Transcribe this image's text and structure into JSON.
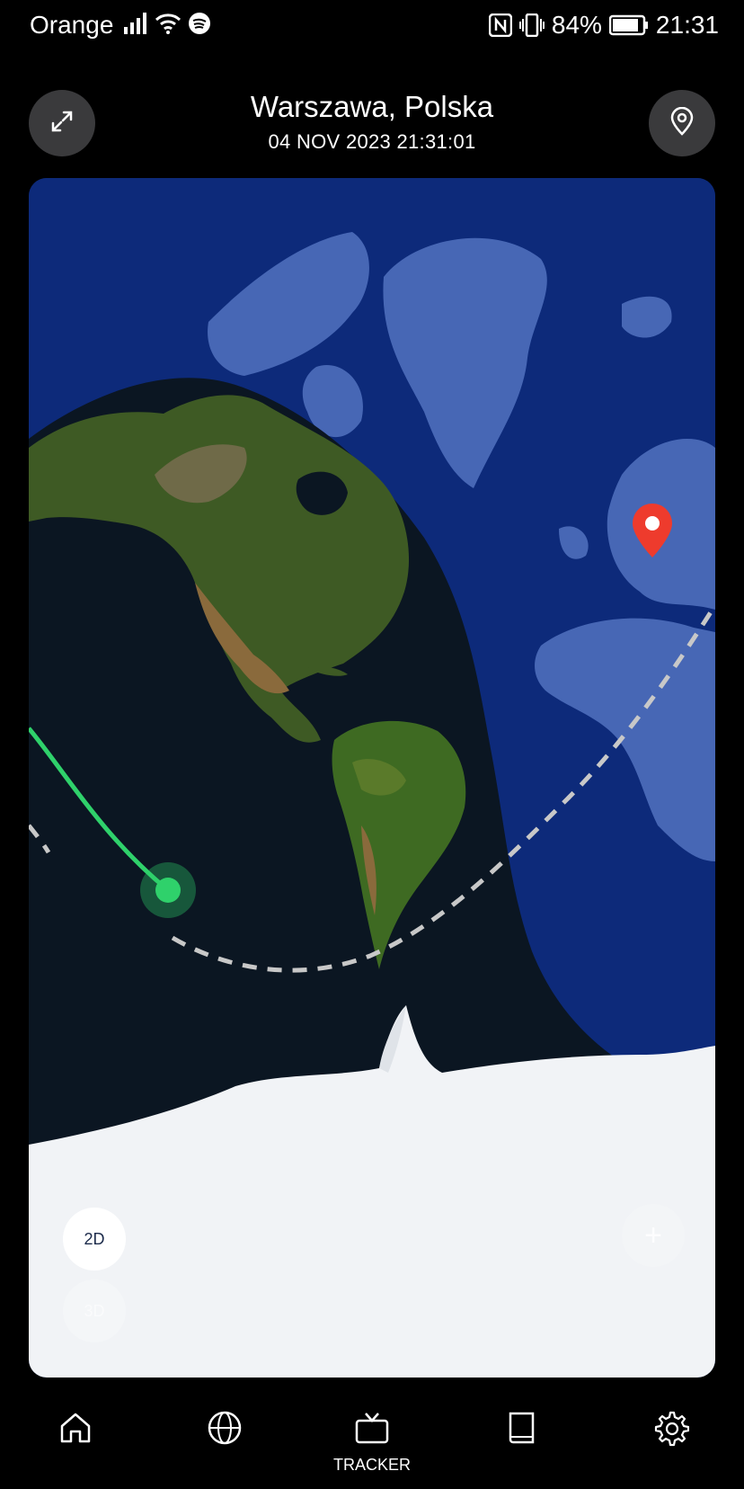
{
  "status_bar": {
    "carrier": "Orange",
    "battery": "84%",
    "time": "21:31",
    "icons": [
      "signal-icon",
      "wifi-icon",
      "spotify-icon",
      "nfc-icon",
      "vibrate-icon",
      "battery-icon"
    ]
  },
  "header": {
    "location": "Warszawa, Polska",
    "datetime": "04 NOV 2023 21:31:01",
    "left_button_icon": "expand-icon",
    "right_button_icon": "location-pin-icon"
  },
  "map": {
    "view_2d_label": "2D",
    "view_3d_label": "3D",
    "zoom_in_label": "+",
    "colors": {
      "ocean_day": "#0d2a7a",
      "night_side": "#0b1622",
      "orbit_past": "#2fd16b",
      "orbit_future": "#c8c8c8",
      "pin": "#ee3b2d"
    }
  },
  "bottom_nav": {
    "items": [
      {
        "icon": "home-icon",
        "label": ""
      },
      {
        "icon": "globe-icon",
        "label": ""
      },
      {
        "icon": "tv-icon",
        "label": "TRACKER"
      },
      {
        "icon": "book-icon",
        "label": ""
      },
      {
        "icon": "gear-icon",
        "label": ""
      }
    ]
  }
}
